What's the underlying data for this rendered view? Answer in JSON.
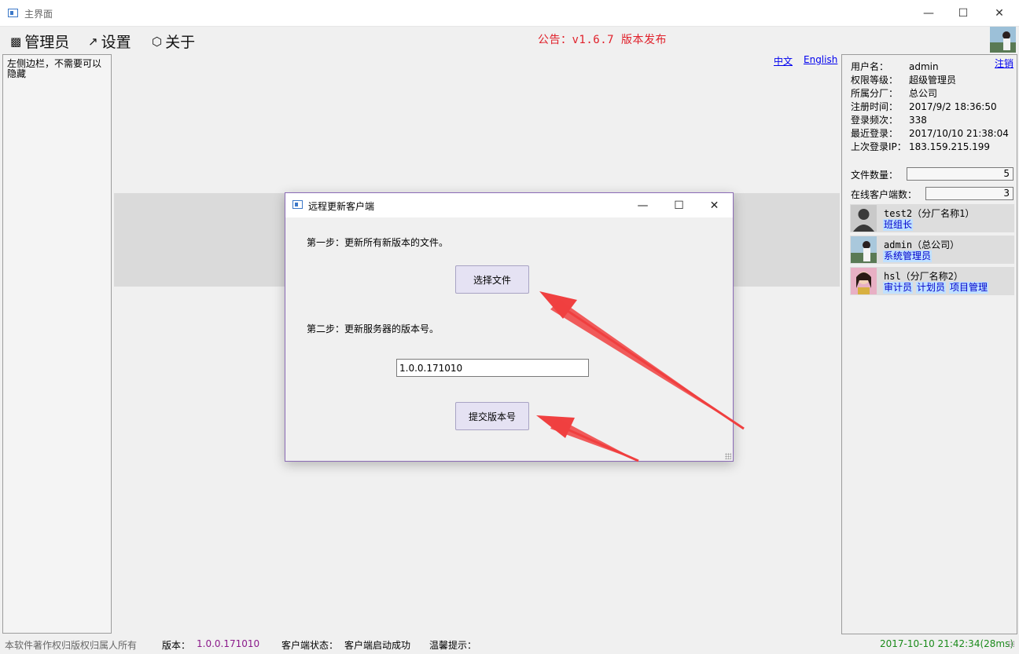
{
  "window": {
    "title": "主界面"
  },
  "menu": {
    "admin": "管理员",
    "settings": "设置",
    "about": "关于"
  },
  "notice": "公告：v1.6.7 版本发布",
  "sidebar": {
    "text": "左侧边栏，不需要可以隐藏"
  },
  "lang": {
    "zh": "中文",
    "en": "English"
  },
  "user": {
    "logout": "注销",
    "rows": [
      {
        "label": "用户名：",
        "value": "admin"
      },
      {
        "label": "权限等级：",
        "value": "超级管理员"
      },
      {
        "label": "所属分厂：",
        "value": "总公司"
      },
      {
        "label": "注册时间：",
        "value": "2017/9/2 18:36:50"
      },
      {
        "label": "登录频次：",
        "value": "338"
      },
      {
        "label": "最近登录：",
        "value": "2017/10/10 21:38:04"
      },
      {
        "label": "上次登录IP：",
        "value": "183.159.215.199"
      }
    ],
    "file_count_label": "文件数量：",
    "file_count": "5",
    "online_label": "在线客户端数：",
    "online_count": "3"
  },
  "clients": [
    {
      "name": "test2（分厂名称1）",
      "roles": [
        "班组长"
      ]
    },
    {
      "name": "admin（总公司）",
      "roles": [
        "系统管理员"
      ]
    },
    {
      "name": "hsl（分厂名称2）",
      "roles": [
        "审计员",
        "计划员",
        "项目管理"
      ]
    }
  ],
  "dialog": {
    "title": "远程更新客户端",
    "step1": "第一步：更新所有新版本的文件。",
    "select_button": "选择文件",
    "step2": "第二步：更新服务器的版本号。",
    "version_value": "1.0.0.171010",
    "submit_button": "提交版本号"
  },
  "status": {
    "copyright": "本软件著作权归版权归属人所有",
    "version_label": "版本：",
    "version": "1.0.0.171010",
    "client_state_label": "客户端状态：",
    "client_state": "客户端启动成功",
    "tip_label": "温馨提示：",
    "time": "2017-10-10 21:42:34(28ms)"
  },
  "colors": {
    "notice": "#e0202a",
    "link": "#0000ee",
    "version": "#8b1a8b",
    "time": "#1a8a1a",
    "arrow": "#f04040"
  }
}
